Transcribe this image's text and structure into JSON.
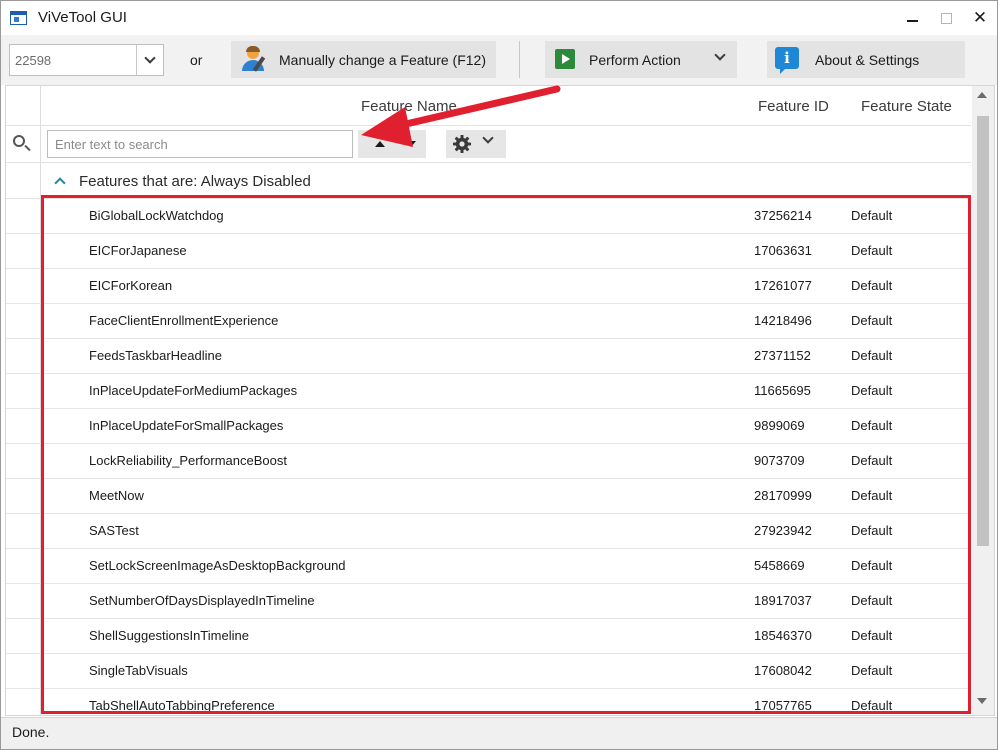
{
  "window": {
    "title": "ViVeTool GUI"
  },
  "toolbar": {
    "build_value": "22598",
    "or_label": "or",
    "manual_label": "Manually change a Feature (F12)",
    "perform_label": "Perform Action",
    "about_label": "About & Settings"
  },
  "grid": {
    "columns": {
      "name": "Feature Name",
      "id": "Feature ID",
      "state": "Feature State"
    },
    "search_placeholder": "Enter text to search",
    "group_label": "Features that are: Always Disabled",
    "rows": [
      {
        "name": "BiGlobalLockWatchdog",
        "id": "37256214",
        "state": "Default"
      },
      {
        "name": "EICForJapanese",
        "id": "17063631",
        "state": "Default"
      },
      {
        "name": "EICForKorean",
        "id": "17261077",
        "state": "Default"
      },
      {
        "name": "FaceClientEnrollmentExperience",
        "id": "14218496",
        "state": "Default"
      },
      {
        "name": "FeedsTaskbarHeadline",
        "id": "27371152",
        "state": "Default"
      },
      {
        "name": "InPlaceUpdateForMediumPackages",
        "id": "11665695",
        "state": "Default"
      },
      {
        "name": "InPlaceUpdateForSmallPackages",
        "id": "9899069",
        "state": "Default"
      },
      {
        "name": "LockReliability_PerformanceBoost",
        "id": "9073709",
        "state": "Default"
      },
      {
        "name": "MeetNow",
        "id": "28170999",
        "state": "Default"
      },
      {
        "name": "SASTest",
        "id": "27923942",
        "state": "Default"
      },
      {
        "name": "SetLockScreenImageAsDesktopBackground",
        "id": "5458669",
        "state": "Default"
      },
      {
        "name": "SetNumberOfDaysDisplayedInTimeline",
        "id": "18917037",
        "state": "Default"
      },
      {
        "name": "ShellSuggestionsInTimeline",
        "id": "18546370",
        "state": "Default"
      },
      {
        "name": "SingleTabVisuals",
        "id": "17608042",
        "state": "Default"
      },
      {
        "name": "TabShellAutoTabbingPreference",
        "id": "17057765",
        "state": "Default"
      }
    ]
  },
  "status": {
    "text": "Done."
  },
  "colors": {
    "annotation": "#e0202e",
    "accent": "#1f8a9c"
  },
  "icons": {
    "app": "app-window-icon",
    "manual": "person-edit-icon",
    "perform": "play-icon",
    "about": "info-icon",
    "search": "search-icon",
    "settings": "gear-icon"
  }
}
